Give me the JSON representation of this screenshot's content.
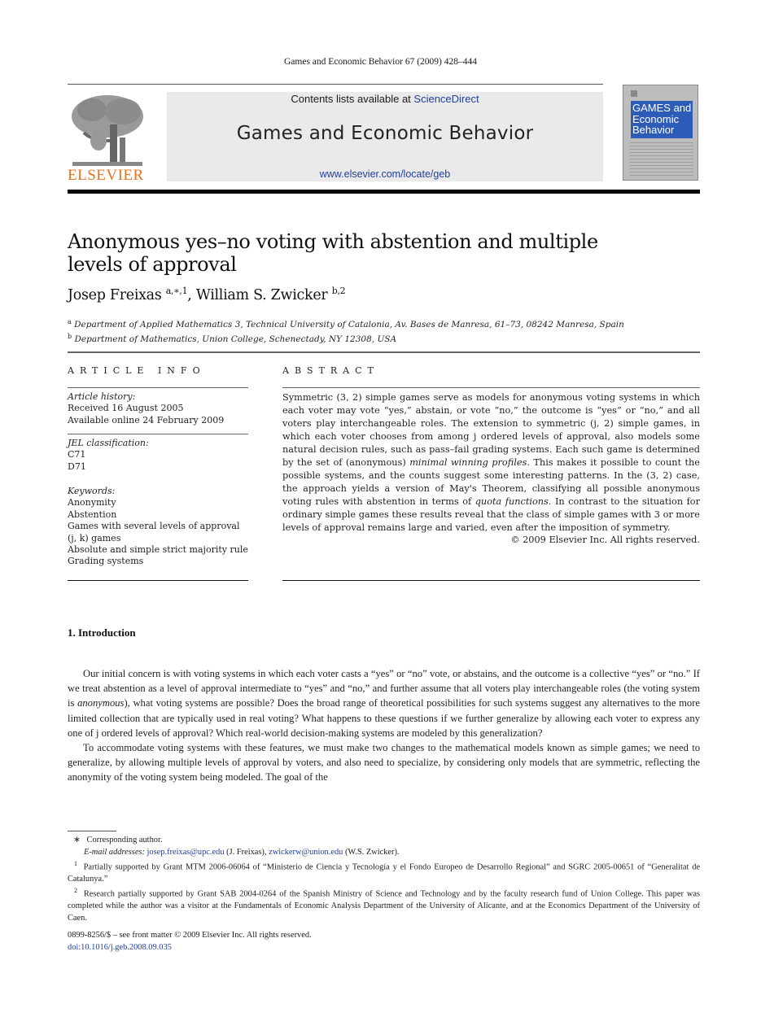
{
  "running_head": "Games and Economic Behavior 67 (2009) 428–444",
  "banner": {
    "publisher": "ELSEVIER",
    "contents_prefix": "Contents lists available at ",
    "contents_link": "ScienceDirect",
    "journal_name": "Games and Economic Behavior",
    "url": "www.elsevier.com/locate/geb",
    "cover_title_lines": [
      "GAMES and",
      "Economic",
      "Behavior"
    ]
  },
  "article": {
    "title": "Anonymous yes–no voting with abstention and multiple levels of approval",
    "authors": [
      {
        "name": "Josep Freixas",
        "marks": "a,∗,1"
      },
      {
        "name": "William S. Zwicker",
        "marks": "b,2"
      }
    ],
    "affiliations": [
      {
        "mark": "a",
        "text": "Department of Applied Mathematics 3, Technical University of Catalonia, Av. Bases de Manresa, 61–73, 08242 Manresa, Spain"
      },
      {
        "mark": "b",
        "text": "Department of Mathematics, Union College, Schenectady, NY 12308, USA"
      }
    ]
  },
  "article_info": {
    "label": "ARTICLE INFO",
    "history_head": "Article history:",
    "received": "Received 16 August 2005",
    "available": "Available online 24 February 2009",
    "jel_head": "JEL classification:",
    "jel_codes": [
      "C71",
      "D71"
    ],
    "keywords_head": "Keywords:",
    "keywords": [
      "Anonymity",
      "Abstention",
      "Games with several levels of approval",
      "(j, k) games",
      "Absolute and simple strict majority rule",
      "Grading systems"
    ]
  },
  "abstract": {
    "label": "ABSTRACT",
    "p1": "Symmetric (3, 2) simple games serve as models for anonymous voting systems in which each voter may vote “yes,” abstain, or vote “no,” the outcome is “yes” or “no,” and all voters play interchangeable roles. The extension to symmetric (j, 2) simple games, in which each voter chooses from among j ordered levels of approval, also models some natural decision rules, such as pass–fail grading systems. Each such game is determined by the set of (anonymous) ",
    "em1": "minimal winning profiles",
    "p2": ". This makes it possible to count the possible systems, and the counts suggest some interesting patterns. In the (3, 2) case, the approach yields a version of May's Theorem, classifying all possible anonymous voting rules with abstention in terms of ",
    "em2": "quota functions",
    "p3": ". In contrast to the situation for ordinary simple games these results reveal that the class of simple games with 3 or more levels of approval remains large and varied, even after the imposition of symmetry.",
    "copyright": "© 2009 Elsevier Inc. All rights reserved."
  },
  "introduction": {
    "heading": "1. Introduction",
    "para1_a": "Our initial concern is with voting systems in which each voter casts a “yes” or “no” vote, or abstains, and the outcome is a collective “yes” or “no.” If we treat abstention as a level of approval intermediate to “yes” and “no,” and further assume that all voters play interchangeable roles (the voting system is ",
    "para1_em": "anonymous",
    "para1_b": "), what voting systems are possible? Does the broad range of theoretical possibilities for such systems suggest any alternatives to the more limited collection that are typically used in real voting? What happens to these questions if we further generalize by allowing each voter to express any one of j ordered levels of approval? Which real-world decision-making systems are modeled by this generalization?",
    "para2": "To accommodate voting systems with these features, we must make two changes to the mathematical models known as simple games; we need to generalize, by allowing multiple levels of approval by voters, and also need to specialize, by considering only models that are symmetric, reflecting the anonymity of the voting system being modeled. The goal of the"
  },
  "footnotes": {
    "star_mark": "∗",
    "corresponding": "Corresponding author.",
    "email_label": "E-mail addresses:",
    "email1": "josep.freixas@upc.edu",
    "email1_who": "(J. Freixas),",
    "email2": "zwickerw@union.edu",
    "email2_who": "(W.S. Zwicker).",
    "fn1_mark": "1",
    "fn1": "Partially supported by Grant MTM 2006-06064 of “Ministerio de Ciencia y Tecnología y el Fondo Europeo de Desarrollo Regional” and SGRC 2005-00651 of “Generalitat de Catalunya.”",
    "fn2_mark": "2",
    "fn2": "Research partially supported by Grant SAB 2004-0264 of the Spanish Ministry of Science and Technology and by the faculty research fund of Union College. This paper was completed while the author was a visitor at the Fundamentals of Economic Analysis Department of the University of Alicante, and at the Economics Department of the University of Caen."
  },
  "front_matter": {
    "issn_line": "0899-8256/$ – see front matter  © 2009 Elsevier Inc. All rights reserved.",
    "doi": "doi:10.1016/j.geb.2008.09.035"
  },
  "colors": {
    "link": "#1f3f9f",
    "elsevier_orange": "#e8711c",
    "banner_bg": "#eaeaea",
    "cover_blue": "#2d5cb8"
  }
}
